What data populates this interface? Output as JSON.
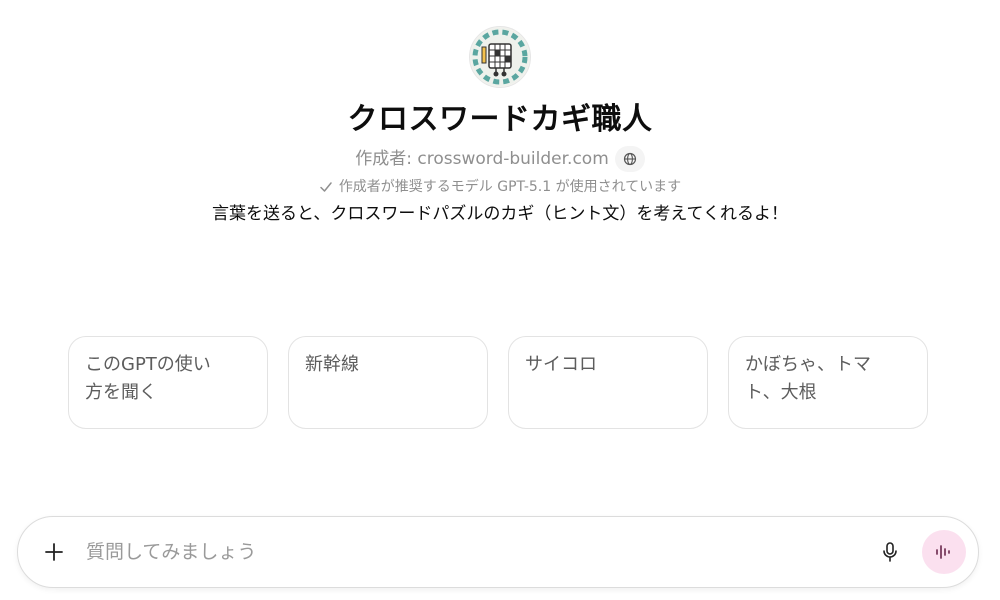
{
  "gpt": {
    "title": "クロスワードカギ職人",
    "author_label": "作成者: crossword-builder.com",
    "model_note": "作成者が推奨するモデル GPT-5.1 が使用されています",
    "description": "言葉を送ると、クロスワードパズルのカギ（ヒント文）を考えてくれるよ！",
    "avatar_icon": "crossword-mascot-icon"
  },
  "starters": [
    {
      "label": "このGPTの使い方を聞く"
    },
    {
      "label": "新幹線"
    },
    {
      "label": "サイコロ"
    },
    {
      "label": "かぼちゃ、トマト、大根"
    }
  ],
  "composer": {
    "placeholder": "質問してみましょう",
    "value": "",
    "icons": [
      "plus-icon",
      "microphone-icon",
      "voice-mode-icon"
    ],
    "accent_color": "#fbe0ef"
  }
}
